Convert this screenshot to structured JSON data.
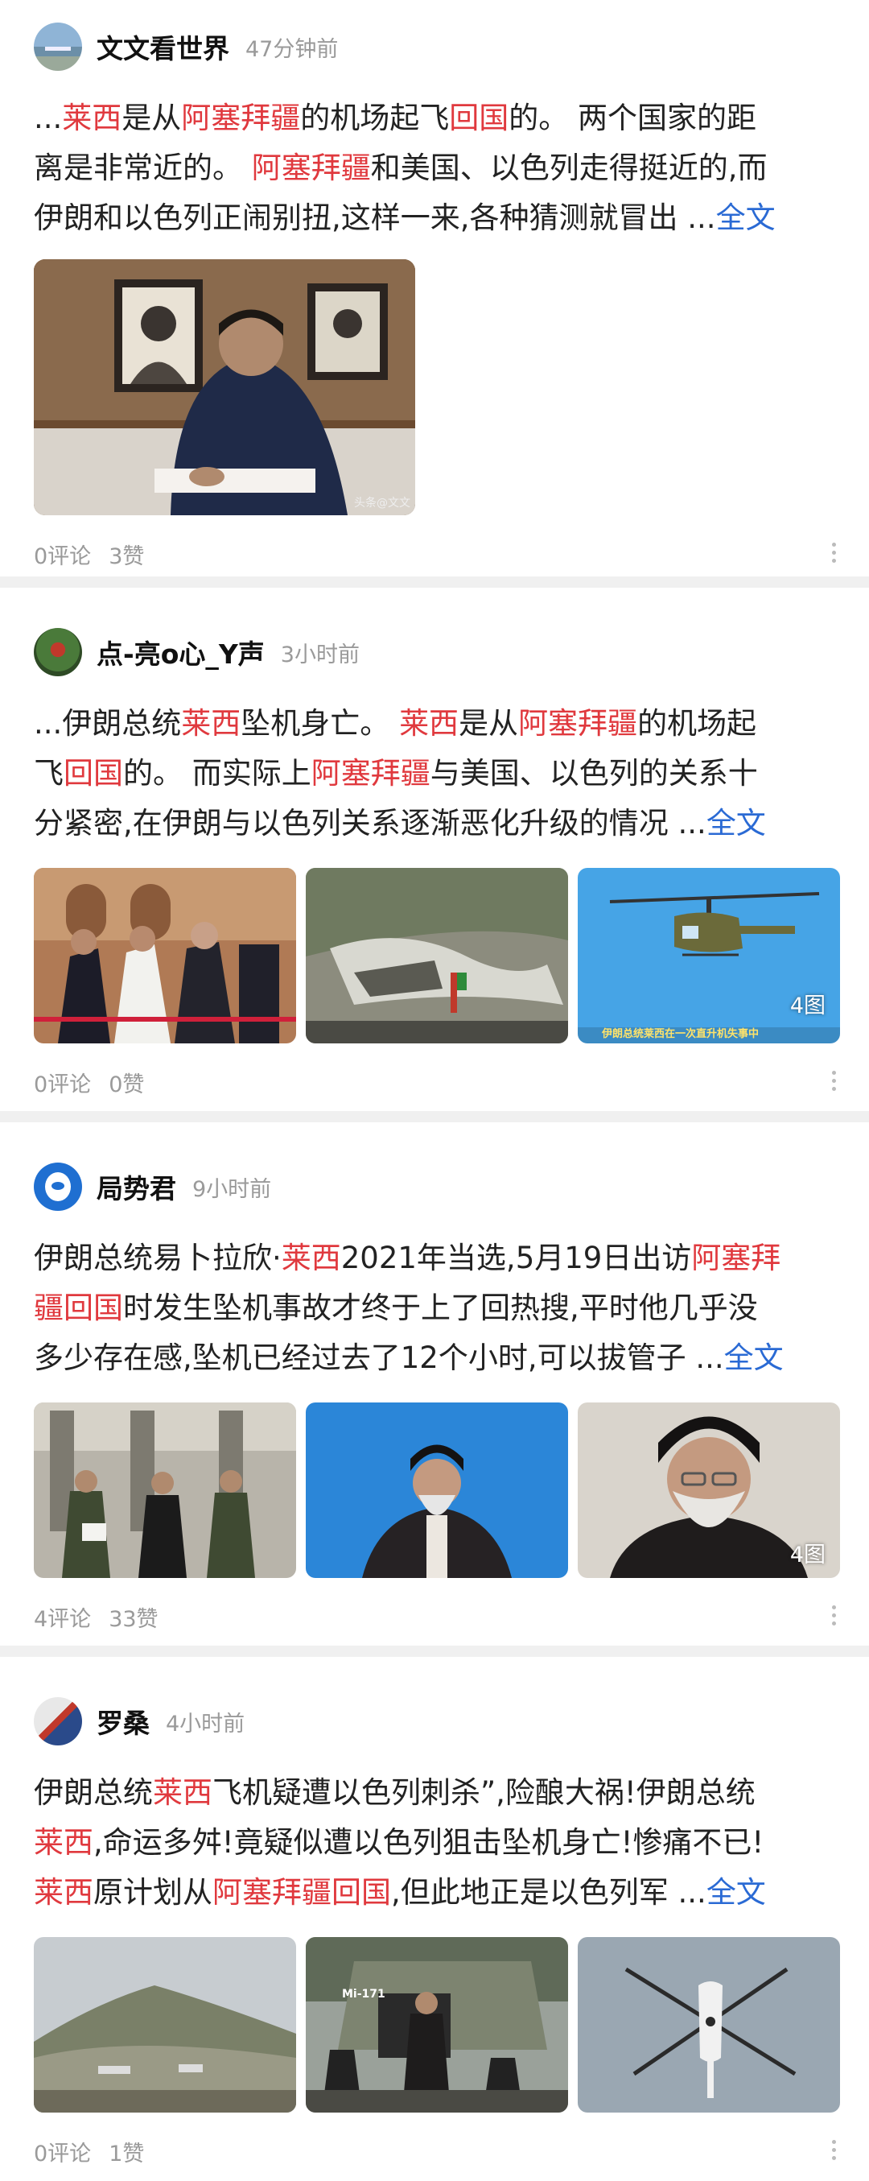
{
  "posts": [
    {
      "author": "文文看世界",
      "time": "47分钟前",
      "lines": [
        [
          {
            "t": "..."
          },
          {
            "t": "莱西",
            "hl": true
          },
          {
            "t": "是从"
          },
          {
            "t": "阿塞拜疆",
            "hl": true
          },
          {
            "t": "的机场起飞"
          },
          {
            "t": "回国",
            "hl": true
          },
          {
            "t": "的。 两个国家的距"
          }
        ],
        [
          {
            "t": "离是非常近的。 "
          },
          {
            "t": "阿塞拜疆",
            "hl": true
          },
          {
            "t": "和美国、以色列走得挺近的,而"
          }
        ],
        [
          {
            "t": "伊朗和以色列正闹别扭,这样一来,各种猜测就冒出 ..."
          },
          {
            "t": "全文",
            "more": true
          }
        ]
      ],
      "watermark": "头条@文文",
      "comments": "0评论",
      "likes": "3赞"
    },
    {
      "author": "点-亮o心_Y声",
      "time": "3小时前",
      "lines": [
        [
          {
            "t": "...伊朗总统"
          },
          {
            "t": "莱西",
            "hl": true
          },
          {
            "t": "坠机身亡。 "
          },
          {
            "t": "莱西",
            "hl": true
          },
          {
            "t": "是从"
          },
          {
            "t": "阿塞拜疆",
            "hl": true
          },
          {
            "t": "的机场起"
          }
        ],
        [
          {
            "t": "飞"
          },
          {
            "t": "回国",
            "hl": true
          },
          {
            "t": "的。 而实际上"
          },
          {
            "t": "阿塞拜疆",
            "hl": true
          },
          {
            "t": "与美国、以色列的关系十"
          }
        ],
        [
          {
            "t": "分紧密,在伊朗与以色列关系逐渐恶化升级的情况 ..."
          },
          {
            "t": "全文",
            "more": true
          }
        ]
      ],
      "image_count": "4图",
      "caption": "伊朗总统莱西在一次直升机失事中",
      "comments": "0评论",
      "likes": "0赞"
    },
    {
      "author": "局势君",
      "time": "9小时前",
      "lines": [
        [
          {
            "t": "伊朗总统易卜拉欣·"
          },
          {
            "t": "莱西",
            "hl": true
          },
          {
            "t": "2021年当选,5月19日出访"
          },
          {
            "t": "阿塞拜",
            "hl": true
          }
        ],
        [
          {
            "t": "疆回国",
            "hl": true
          },
          {
            "t": "时发生坠机事故才终于上了回热搜,平时他几乎没"
          }
        ],
        [
          {
            "t": "多少存在感,坠机已经过去了12个小时,可以拔管子 ..."
          },
          {
            "t": "全文",
            "more": true
          }
        ]
      ],
      "image_count": "4图",
      "comments": "4评论",
      "likes": "33赞"
    },
    {
      "author": "罗桑",
      "time": "4小时前",
      "lines": [
        [
          {
            "t": "伊朗总统"
          },
          {
            "t": "莱西",
            "hl": true
          },
          {
            "t": "飞机疑遭以色列刺杀”,险酿大祸!伊朗总统"
          }
        ],
        [
          {
            "t": "莱西",
            "hl": true
          },
          {
            "t": ",命运多舛!竟疑似遭以色列狙击坠机身亡!惨痛不已!"
          }
        ],
        [
          {
            "t": "莱西",
            "hl": true
          },
          {
            "t": "原计划从"
          },
          {
            "t": "阿塞拜疆",
            "hl": true
          },
          {
            "t": "回国",
            "hl": true
          },
          {
            "t": ",但此地正是以色列军 ..."
          },
          {
            "t": "全文",
            "more": true
          }
        ]
      ],
      "heli_label": "Mi-171",
      "comments": "0评论",
      "likes": "1赞"
    }
  ],
  "colors": {
    "highlight": "#e0393e",
    "link": "#2a6ad4",
    "meta": "#9a9a9a"
  }
}
